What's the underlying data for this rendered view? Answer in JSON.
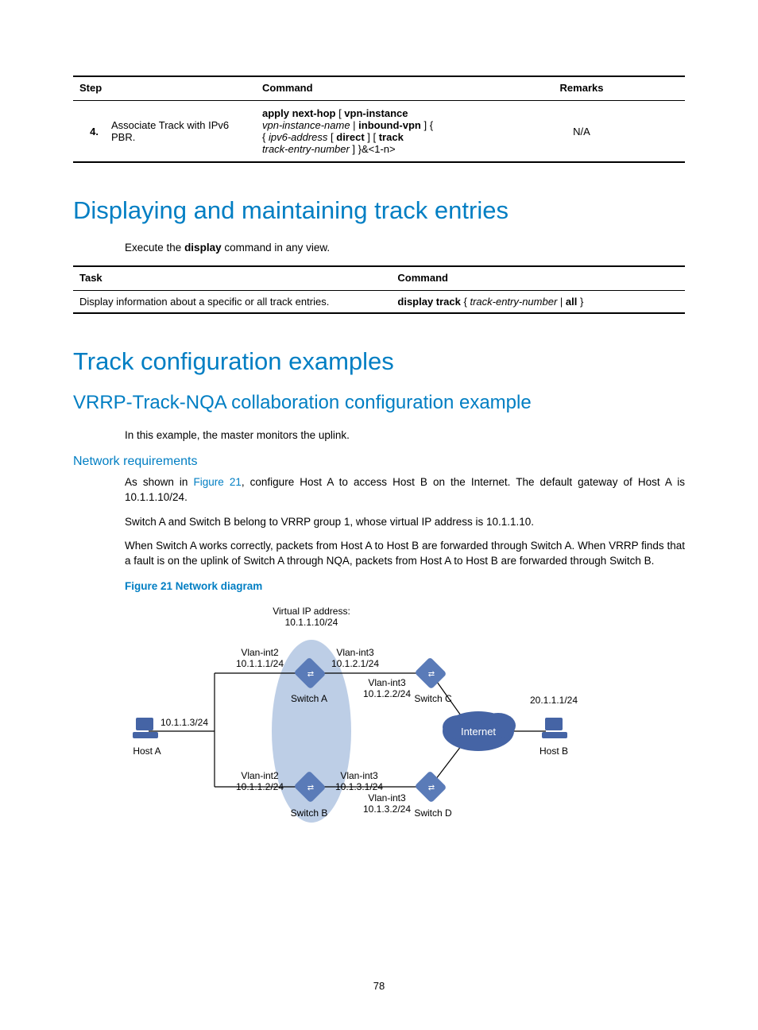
{
  "table1": {
    "headers": {
      "step": "Step",
      "command": "Command",
      "remarks": "Remarks"
    },
    "row": {
      "num": "4.",
      "desc": "Associate Track with IPv6 PBR.",
      "cmd_parts": {
        "p1": "apply next-hop",
        "p2": " [ ",
        "p3": "vpn-instance",
        "p4": " ",
        "p5": "vpn-instance-name",
        "p6": " | ",
        "p7": "inbound-vpn",
        "p8": " ] { ",
        "p9": "ipv6-address",
        "p10": " [ ",
        "p11": "direct",
        "p12": " ] [ ",
        "p13": "track",
        "p14": " ",
        "p15": "track-entry-number",
        "p16": " ] }&<1-n>"
      },
      "remarks": "N/A"
    }
  },
  "h1a": "Displaying and maintaining track entries",
  "p1_pre": "Execute the ",
  "p1_b": "display",
  "p1_post": " command in any view.",
  "table2": {
    "headers": {
      "task": "Task",
      "command": "Command"
    },
    "row": {
      "task": "Display information about a specific or all track entries.",
      "cmd": {
        "p1": "display track",
        "p2": " { ",
        "p3": "track-entry-number",
        "p4": " | ",
        "p5": "all",
        "p6": " }"
      }
    }
  },
  "h1b": "Track configuration examples",
  "h2a": "VRRP-Track-NQA collaboration configuration example",
  "p2": "In this example, the master monitors the uplink.",
  "h3a": "Network requirements",
  "p3_pre": "As shown in ",
  "p3_link": "Figure 21",
  "p3_post": ", configure Host A to access Host B on the Internet. The default gateway of Host A is 10.1.1.10/24.",
  "p4": "Switch A and Switch B belong to VRRP group 1, whose virtual IP address is 10.1.1.10.",
  "p5": "When Switch A works correctly, packets from Host A to Host B are forwarded through Switch A. When VRRP finds that a fault is on the uplink of Switch A through NQA, packets from Host A to Host B are forwarded through Switch B.",
  "figcap": "Figure 21 Network diagram",
  "diagram": {
    "vip_l1": "Virtual IP address:",
    "vip_l2": "10.1.1.10/24",
    "swa_int2_l1": "Vlan-int2",
    "swa_int2_l2": "10.1.1.1/24",
    "swa_int3_l1": "Vlan-int3",
    "swa_int3_l2": "10.1.2.1/24",
    "swc_int3_l1": "Vlan-int3",
    "swc_int3_l2": "10.1.2.2/24",
    "swa_label": "Switch A",
    "swc_label": "Switch C",
    "hosta_ip": "10.1.1.3/24",
    "hosta_label": "Host A",
    "hostb_ip": "20.1.1.1/24",
    "hostb_label": "Host B",
    "internet": "Internet",
    "swb_int2_l1": "Vlan-int2",
    "swb_int2_l2": "10.1.1.2/24",
    "swb_int3_l1": "Vlan-int3",
    "swb_int3_l2": "10.1.3.1/24",
    "swd_int3_l1": "Vlan-int3",
    "swd_int3_l2": "10.1.3.2/24",
    "swb_label": "Switch B",
    "swd_label": "Switch D"
  },
  "page_num": "78"
}
